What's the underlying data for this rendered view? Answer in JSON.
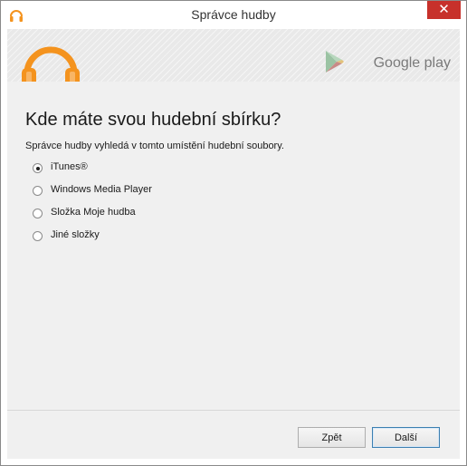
{
  "window": {
    "title": "Správce hudby"
  },
  "banner": {
    "brand_text": "Google play"
  },
  "main": {
    "heading": "Kde máte svou hudební sbírku?",
    "description": "Správce hudby vyhledá v tomto umístění hudební soubory.",
    "options": [
      {
        "label": "iTunes®",
        "selected": true
      },
      {
        "label": "Windows Media Player",
        "selected": false
      },
      {
        "label": "Složka Moje hudba",
        "selected": false
      },
      {
        "label": "Jiné složky",
        "selected": false
      }
    ]
  },
  "footer": {
    "back_label": "Zpět",
    "next_label": "Další"
  },
  "colors": {
    "accent_orange": "#f4931e",
    "close_red": "#c7312b"
  }
}
